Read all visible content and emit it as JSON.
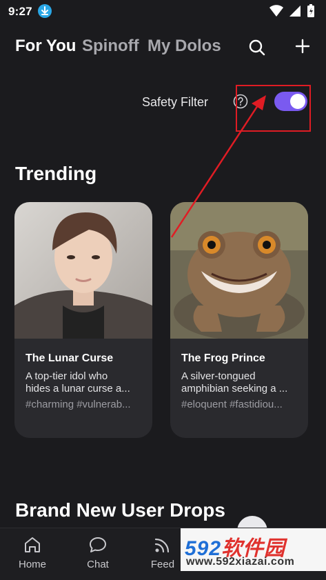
{
  "status_bar": {
    "time": "9:27"
  },
  "top_nav": {
    "tabs": [
      {
        "label": "For You"
      },
      {
        "label": "Spinoff"
      },
      {
        "label": "My Dolos"
      }
    ],
    "icons": [
      "search-icon",
      "plus-icon"
    ]
  },
  "safety_filter": {
    "label": "Safety Filter",
    "enabled": true,
    "toggle_color": "#7a5af0"
  },
  "sections": {
    "trending_title": "Trending",
    "new_drops_title": "Brand New User Drops"
  },
  "cards": [
    {
      "name": "The Lunar Curse",
      "desc_line1": "A top-tier idol who",
      "desc_line2": "hides a lunar curse a...",
      "tags": "#charming #vulnerab..."
    },
    {
      "name": "The Frog Prince",
      "desc_line1": "A silver-tongued",
      "desc_line2": "amphibian seeking a ...",
      "tags": "#eloquent #fastidiou..."
    }
  ],
  "bottom_nav": {
    "items": [
      {
        "label": "Home",
        "icon": "home-icon"
      },
      {
        "label": "Chat",
        "icon": "chat-bubble-icon"
      },
      {
        "label": "Feed",
        "icon": "rss-feed-icon"
      }
    ]
  },
  "watermark": {
    "brand_num": "592",
    "brand_cn": "软件园",
    "url": "www.592xiazai.com"
  },
  "colors": {
    "background": "#1b1b1e",
    "card": "#2a2a2e",
    "accent": "#7a5af0",
    "annotation": "#e01c24"
  }
}
